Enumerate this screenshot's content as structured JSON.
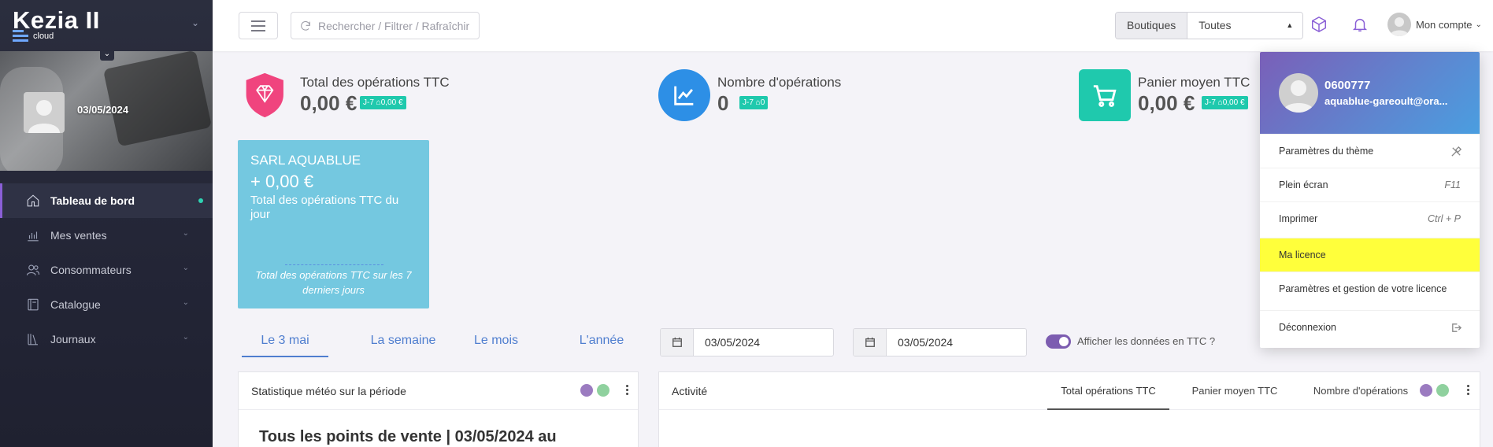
{
  "app": {
    "logo": "Kezia II",
    "logo_sub": "cloud"
  },
  "sidebar": {
    "profile_date": "03/05/2024",
    "items": [
      {
        "label": "Tableau de bord",
        "icon": "home-icon",
        "active": true
      },
      {
        "label": "Mes ventes",
        "icon": "bar-chart-icon"
      },
      {
        "label": "Consommateurs",
        "icon": "users-icon"
      },
      {
        "label": "Catalogue",
        "icon": "book-icon"
      },
      {
        "label": "Journaux",
        "icon": "library-icon"
      }
    ]
  },
  "header": {
    "search_label": "Rechercher / Filtrer / Rafraîchir",
    "shop_label": "Boutiques",
    "shop_value": "Toutes",
    "account_label": "Mon compte"
  },
  "kpis": [
    {
      "title": "Total des opérations TTC",
      "value": "0,00 €",
      "badge": "J-7 ⌂0,00 €",
      "color": "#f0447e"
    },
    {
      "title": "Nombre d'opérations",
      "value": "0",
      "badge": "J-7 ⌂0",
      "color": "#2d8fe6"
    },
    {
      "title": "Panier moyen TTC",
      "value": "0,00 €",
      "badge": "J-7 ⌂0,00 €",
      "color": "#1fc9ad"
    }
  ],
  "aqua_card": {
    "name": "SARL AQUABLUE",
    "value": "+ 0,00 €",
    "desc": "Total des opérations TTC du jour",
    "footer": "Total des opérations TTC sur les 7 derniers jours"
  },
  "period_tabs": [
    "Le 3 mai",
    "La semaine",
    "Le mois",
    "L'année"
  ],
  "dates": {
    "from": "03/05/2024",
    "to": "03/05/2024"
  },
  "toggle_label": "Afficher les données en TTC ?",
  "panels": {
    "meteo_title": "Statistique météo sur la période",
    "meteo_big": "Tous les points de vente | 03/05/2024 au",
    "activity_title": "Activité",
    "activity_tabs": [
      "Total opérations TTC",
      "Panier moyen TTC",
      "Nombre d'opérations"
    ]
  },
  "dropdown": {
    "user_id": "0600777",
    "email": "aquablue-gareoult@ora...",
    "items": [
      {
        "label": "Paramètres du thème",
        "shortcut": ""
      },
      {
        "label": "Plein écran",
        "shortcut": "F11"
      },
      {
        "label": "Imprimer",
        "shortcut": "Ctrl + P"
      },
      {
        "label": "Ma licence",
        "shortcut": ""
      },
      {
        "label": "Paramètres et gestion de votre licence",
        "shortcut": ""
      },
      {
        "label": "Déconnexion",
        "shortcut": ""
      }
    ]
  },
  "colors": {
    "accent": "#8a5fd6",
    "highlight": "#ffff3b",
    "aqua": "#74c8e0",
    "dot_purple": "#9b7bc0",
    "dot_green": "#8fd19e"
  }
}
